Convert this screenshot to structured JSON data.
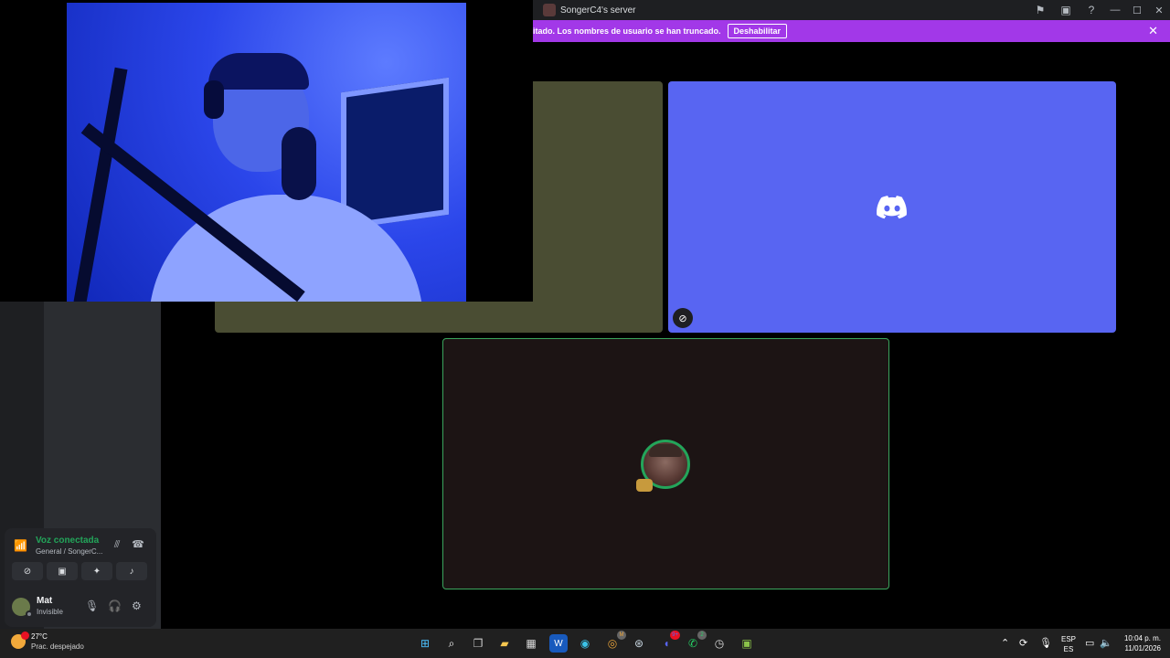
{
  "titlebar": {
    "server_name": "SongerC4's server",
    "icons": [
      "flag-icon",
      "screen-share-icon",
      "help-icon"
    ],
    "window_controls": [
      "minimize",
      "maximize",
      "close"
    ]
  },
  "banner": {
    "text": "itado. Los nombres de usuario se han truncado.",
    "button_label": "Deshabilitar",
    "close_glyph": "✕"
  },
  "voice_panel": {
    "status_title": "Voz conectada",
    "status_subtitle": "General / SongerC..."
  },
  "user": {
    "name": "Mat",
    "status": "Invisible"
  },
  "taskbar": {
    "weather_temp": "27°C",
    "weather_desc": "Prac. despejado",
    "lang_primary": "ESP",
    "lang_secondary": "ES",
    "time": "10:04 p. m.",
    "date": "11/01/2026",
    "badge_discord": "9+",
    "badge_whatsapp": "2",
    "badge_chrome": "M"
  },
  "colors": {
    "discord_blurple": "#5865f2",
    "banner_purple": "#a238e8",
    "voice_green": "#23a55a"
  }
}
